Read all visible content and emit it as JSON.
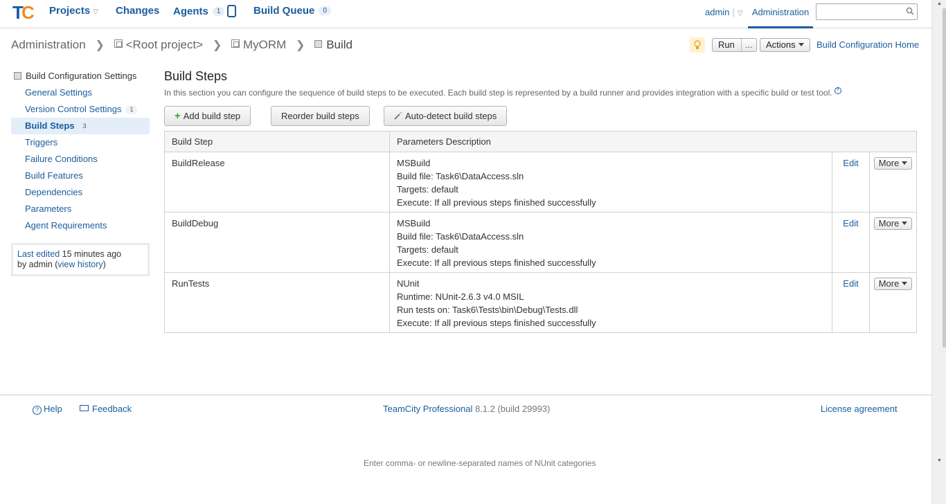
{
  "app": {
    "logo_text": "TC",
    "nav": {
      "projects": "Projects",
      "changes": "Changes",
      "agents": "Agents",
      "agents_count": "1",
      "build_queue": "Build Queue",
      "build_queue_count": "0"
    },
    "user": "admin",
    "administration": "Administration",
    "search_placeholder": ""
  },
  "breadcrumb": {
    "items": [
      "Administration",
      "<Root project>",
      "MyORM",
      "Build"
    ]
  },
  "toolbar": {
    "run": "Run",
    "run_more": "...",
    "actions": "Actions",
    "home_link": "Build Configuration Home"
  },
  "sidebar": {
    "header": "Build Configuration Settings",
    "items": [
      {
        "label": "General Settings",
        "badge": ""
      },
      {
        "label": "Version Control Settings",
        "badge": "1"
      },
      {
        "label": "Build Steps",
        "badge": "3"
      },
      {
        "label": "Triggers",
        "badge": ""
      },
      {
        "label": "Failure Conditions",
        "badge": ""
      },
      {
        "label": "Build Features",
        "badge": ""
      },
      {
        "label": "Dependencies",
        "badge": ""
      },
      {
        "label": "Parameters",
        "badge": ""
      },
      {
        "label": "Agent Requirements",
        "badge": ""
      }
    ],
    "last_edited": {
      "label": "Last edited",
      "time": "15 minutes ago",
      "by": "by admin (",
      "history": "view history",
      "close": ")"
    }
  },
  "main": {
    "title": "Build Steps",
    "description": "In this section you can configure the sequence of build steps to be executed. Each build step is represented by a build runner and provides integration with a specific build or test tool.",
    "buttons": {
      "add": "Add build step",
      "reorder": "Reorder build steps",
      "autodetect": "Auto-detect build steps"
    },
    "table": {
      "headers": [
        "Build Step",
        "Parameters Description"
      ],
      "edit_label": "Edit",
      "more_label": "More",
      "rows": [
        {
          "name": "BuildRelease",
          "params": [
            "MSBuild",
            "Build file: Task6\\DataAccess.sln",
            "Targets: default",
            "Execute: If all previous steps finished successfully"
          ]
        },
        {
          "name": "BuildDebug",
          "params": [
            "MSBuild",
            "Build file: Task6\\DataAccess.sln",
            "Targets: default",
            "Execute: If all previous steps finished successfully"
          ]
        },
        {
          "name": "RunTests",
          "params": [
            "NUnit",
            "Runtime: NUnit-2.6.3 v4.0 MSIL",
            "Run tests on: Task6\\Tests\\bin\\Debug\\Tests.dll",
            "Execute: If all previous steps finished successfully"
          ]
        }
      ]
    }
  },
  "footer": {
    "help": "Help",
    "feedback": "Feedback",
    "product": "TeamCity Professional",
    "version": "8.1.2 (build 29993)",
    "license": "License agreement",
    "hint": "Enter comma- or newline-separated names of NUnit categories"
  },
  "colors": {
    "link": "#1a5c9e",
    "active_bg": "#e4eef8",
    "logo_orange": "#f28a1e"
  }
}
